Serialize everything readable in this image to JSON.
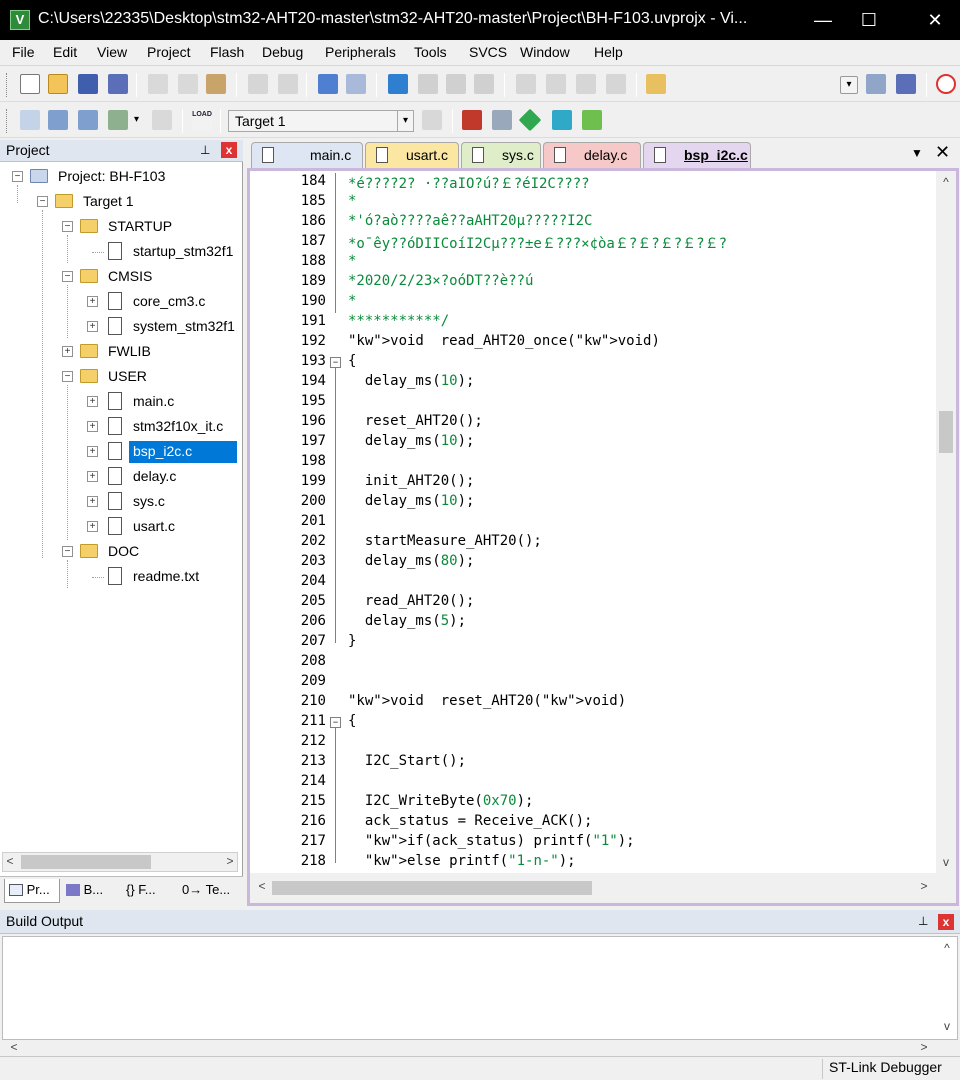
{
  "window": {
    "title": "C:\\Users\\22335\\Desktop\\stm32-AHT20-master\\stm32-AHT20-master\\Project\\BH-F103.uvprojx -   Vi...",
    "minimize_glyph": "—",
    "maximize_glyph": "☐",
    "close_glyph": "✕",
    "app_icon_letter": "V"
  },
  "menu": [
    "File",
    "Edit",
    "View",
    "Project",
    "Flash",
    "Debug",
    "Peripherals",
    "Tools",
    "SVCS",
    "Window",
    "Help"
  ],
  "toolbar2": {
    "target": "Target 1",
    "load_label": "LOAD"
  },
  "project_pane": {
    "title": "Project",
    "pin": "⊥",
    "close": "x",
    "tree": {
      "root": "Project: BH-F103",
      "target": "Target 1",
      "groups": [
        {
          "name": "STARTUP",
          "expanded": true,
          "files": [
            "startup_stm32f1"
          ]
        },
        {
          "name": "CMSIS",
          "expanded": true,
          "files": [
            "core_cm3.c",
            "system_stm32f1"
          ]
        },
        {
          "name": "FWLIB",
          "expanded": false,
          "files": []
        },
        {
          "name": "USER",
          "expanded": true,
          "files": [
            "main.c",
            "stm32f10x_it.c",
            "bsp_i2c.c",
            "delay.c",
            "sys.c",
            "usart.c"
          ]
        },
        {
          "name": "DOC",
          "expanded": true,
          "files": [
            "readme.txt"
          ]
        }
      ],
      "selected": "bsp_i2c.c"
    },
    "tabs": [
      "Pr...",
      "B...",
      "{} F...",
      "0→ Te..."
    ]
  },
  "editor": {
    "tabs": [
      {
        "label": "main.c",
        "color": "#dde6f2"
      },
      {
        "label": "usart.c",
        "color": "#fbe6a2"
      },
      {
        "label": "sys.c",
        "color": "#dfeec9"
      },
      {
        "label": "delay.c",
        "color": "#f6c8c8"
      },
      {
        "label": "bsp_i2c.c",
        "color": "#e4d6ef",
        "active": true
      }
    ],
    "tab_menu": "▼",
    "tab_close": "✕",
    "lines": [
      {
        "n": "184",
        "t": "*é????2? ·??aIO?ú?￡?éI2C????",
        "k": "cm"
      },
      {
        "n": "185",
        "t": "*",
        "k": "cm"
      },
      {
        "n": "186",
        "t": "*'ó?aò????aê??aAHT20μ?????I2C",
        "k": "cm"
      },
      {
        "n": "187",
        "t": "*o¯êy??óDIICoíI2Cμ???±e￡???×¢òa￡?￡?￡?￡?￡?",
        "k": "cm"
      },
      {
        "n": "188",
        "t": "*",
        "k": "cm"
      },
      {
        "n": "189",
        "t": "*2020/2/23×?oóDT??è??ú",
        "k": "cm"
      },
      {
        "n": "190",
        "t": "*",
        "k": "cm"
      },
      {
        "n": "191",
        "t": "***********/",
        "k": "cm"
      },
      {
        "n": "192",
        "t": "void  read_AHT20_once(void)",
        "k": "fn"
      },
      {
        "n": "193",
        "t": "{",
        "k": "plain"
      },
      {
        "n": "194",
        "t": "  delay_ms(10);",
        "k": "call"
      },
      {
        "n": "195",
        "t": "",
        "k": "plain"
      },
      {
        "n": "196",
        "t": "  reset_AHT20();",
        "k": "plain"
      },
      {
        "n": "197",
        "t": "  delay_ms(10);",
        "k": "call"
      },
      {
        "n": "198",
        "t": "",
        "k": "plain"
      },
      {
        "n": "199",
        "t": "  init_AHT20();",
        "k": "plain"
      },
      {
        "n": "200",
        "t": "  delay_ms(10);",
        "k": "call"
      },
      {
        "n": "201",
        "t": "",
        "k": "plain"
      },
      {
        "n": "202",
        "t": "  startMeasure_AHT20();",
        "k": "plain"
      },
      {
        "n": "203",
        "t": "  delay_ms(80);",
        "k": "call"
      },
      {
        "n": "204",
        "t": "",
        "k": "plain"
      },
      {
        "n": "205",
        "t": "  read_AHT20();",
        "k": "plain"
      },
      {
        "n": "206",
        "t": "  delay_ms(5);",
        "k": "call"
      },
      {
        "n": "207",
        "t": "}",
        "k": "plain"
      },
      {
        "n": "208",
        "t": "",
        "k": "plain"
      },
      {
        "n": "209",
        "t": "",
        "k": "plain"
      },
      {
        "n": "210",
        "t": "void  reset_AHT20(void)",
        "k": "fn"
      },
      {
        "n": "211",
        "t": "{",
        "k": "plain"
      },
      {
        "n": "212",
        "t": "",
        "k": "plain"
      },
      {
        "n": "213",
        "t": "  I2C_Start();",
        "k": "plain"
      },
      {
        "n": "214",
        "t": "",
        "k": "plain"
      },
      {
        "n": "215",
        "t": "  I2C_WriteByte(0x70);",
        "k": "call"
      },
      {
        "n": "216",
        "t": "  ack_status = Receive_ACK();",
        "k": "plain"
      },
      {
        "n": "217",
        "t": "  if(ack_status) printf(\"1\");",
        "k": "ifs"
      },
      {
        "n": "218",
        "t": "  else printf(\"1-n-\");",
        "k": "ifs"
      }
    ]
  },
  "build_pane": {
    "title": "Build Output"
  },
  "status": {
    "debugger": "ST-Link Debugger"
  },
  "scroll": {
    "up": "^",
    "down": "v",
    "left": "<",
    "right": ">"
  }
}
